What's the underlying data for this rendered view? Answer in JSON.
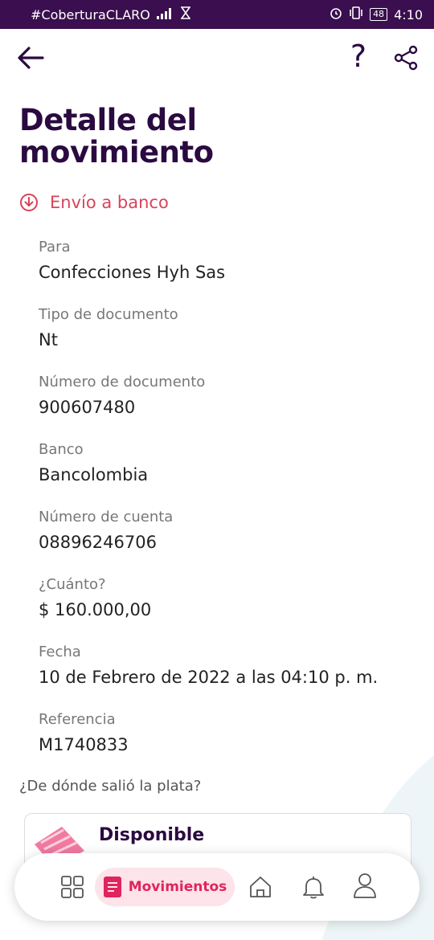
{
  "status_bar": {
    "carrier": "#CoberturaCLARO",
    "battery": "48",
    "time": "4:10"
  },
  "header": {
    "help_label": "?",
    "title": "Detalle del movimiento"
  },
  "transaction": {
    "type_label": "Envío a banco",
    "fields": [
      {
        "label": "Para",
        "value": "Confecciones Hyh Sas"
      },
      {
        "label": "Tipo de documento",
        "value": "Nt"
      },
      {
        "label": "Número de documento",
        "value": "900607480"
      },
      {
        "label": "Banco",
        "value": "Bancolombia"
      },
      {
        "label": "Número de cuenta",
        "value": "08896246706"
      },
      {
        "label": "¿Cuánto?",
        "value": "$ 160.000,00"
      },
      {
        "label": "Fecha",
        "value": "10 de Febrero de 2022 a las 04:10 p. m."
      },
      {
        "label": "Referencia",
        "value": "M1740833"
      }
    ]
  },
  "source": {
    "question": "¿De dónde salió la plata?",
    "card_title": "Disponible"
  },
  "bottom_nav": {
    "active_label": "Movimientos"
  },
  "colors": {
    "brand_dark": "#2a0a40",
    "status_bar": "#3a0e4f",
    "accent_pink": "#e0245e",
    "type_red": "#d9435a"
  }
}
